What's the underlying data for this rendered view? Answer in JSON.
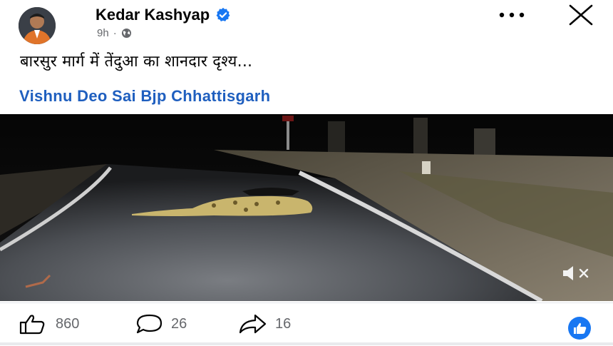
{
  "post": {
    "author": "Kedar Kashyap",
    "time": "9h",
    "time_separator": "·",
    "text": "बारसुर मार्ग में तेंदुआ का शानदार दृश्य...",
    "page_tag": "Vishnu Deo Sai Bjp Chhattisgarh"
  },
  "actions": {
    "likes": "860",
    "comments": "26",
    "shares": "16"
  },
  "icons": {
    "verified": "verified-badge-icon",
    "audience": "globe-icon",
    "more": "more-options-icon",
    "close": "close-icon",
    "like": "thumbs-up-icon",
    "comment": "comment-bubble-icon",
    "share": "share-arrow-icon",
    "mute": "muted-speaker-icon",
    "reaction": "like-reaction-icon"
  },
  "colors": {
    "link": "#1f5fbf",
    "verified": "#1877f2",
    "muted_text": "#65676b"
  }
}
